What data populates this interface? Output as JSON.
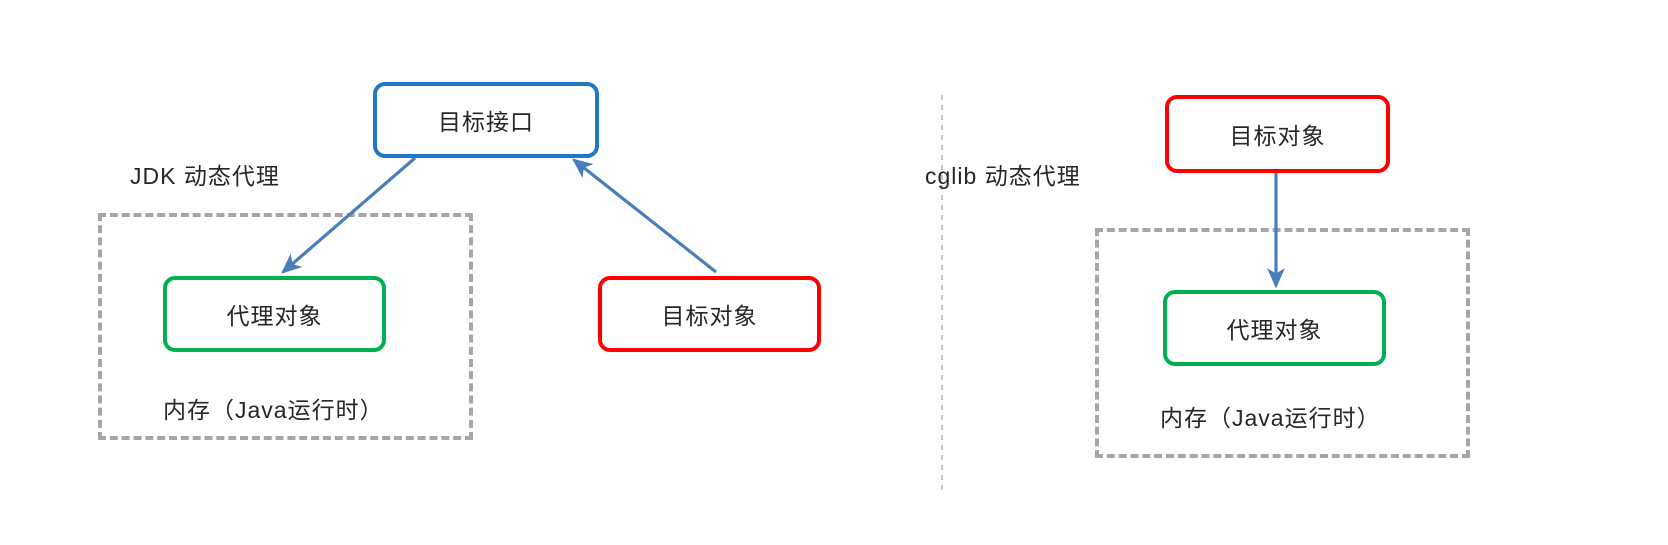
{
  "diagram": {
    "title_left": "JDK 动态代理",
    "title_right": "cglib 动态代理",
    "colors": {
      "interface_border": "#1f78c1",
      "proxy_border": "#00b050",
      "target_border": "#ff0000",
      "region_border": "#a6a6a6",
      "arrow": "#4a7ebb",
      "divider": "#c9c9c9",
      "text": "#262626",
      "background": "#ffffff"
    }
  },
  "left_panel": {
    "label": "JDK 动态代理",
    "nodes": {
      "interface": "目标接口",
      "proxy": "代理对象",
      "target": "目标对象"
    },
    "region_caption": "内存（Java运行时）"
  },
  "right_panel": {
    "label": "cglib 动态代理",
    "nodes": {
      "target": "目标对象",
      "proxy": "代理对象"
    },
    "region_caption": "内存（Java运行时）"
  }
}
